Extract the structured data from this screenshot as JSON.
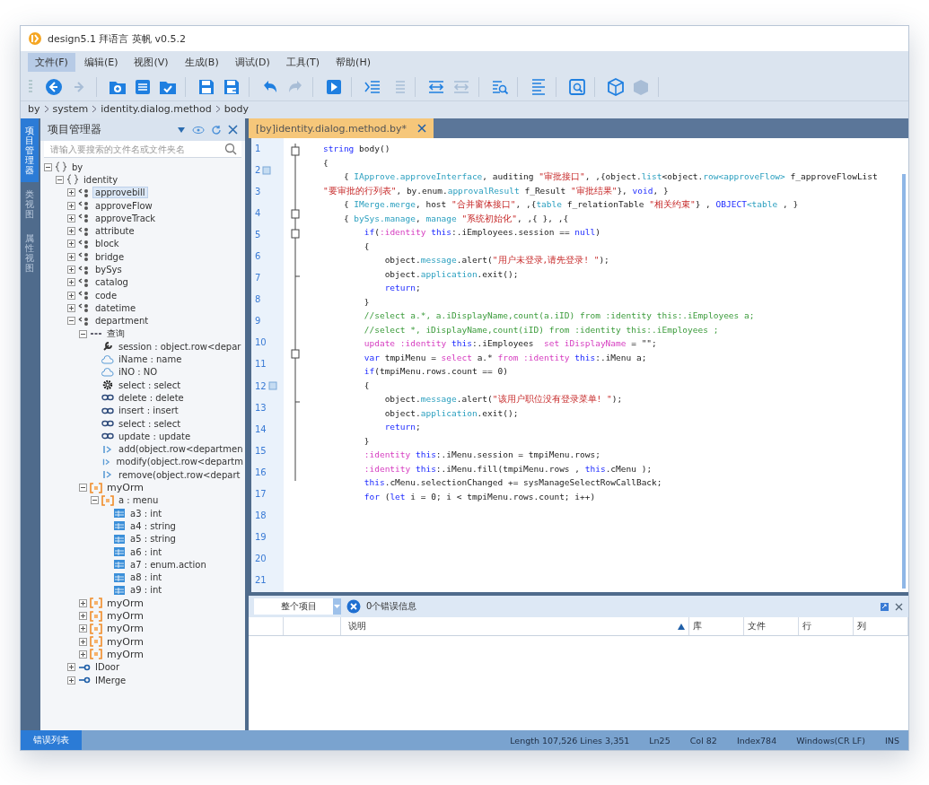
{
  "window": {
    "title": "design5.1 拜语言 英帆 v0.5.2"
  },
  "menu": [
    {
      "label": "文件(F)",
      "selected": true
    },
    {
      "label": "编辑(E)",
      "selected": false
    },
    {
      "label": "视图(V)",
      "selected": false
    },
    {
      "label": "生成(B)",
      "selected": false
    },
    {
      "label": "调试(D)",
      "selected": false
    },
    {
      "label": "工具(T)",
      "selected": false
    },
    {
      "label": "帮助(H)",
      "selected": false
    }
  ],
  "toolbar": [
    [
      {
        "kind": "back",
        "disabled": false
      },
      {
        "kind": "forward",
        "disabled": true
      }
    ],
    [
      {
        "kind": "new-folder",
        "disabled": false
      },
      {
        "kind": "list",
        "disabled": false
      },
      {
        "kind": "folder-check",
        "disabled": false
      }
    ],
    [
      {
        "kind": "save",
        "disabled": false
      },
      {
        "kind": "save-all",
        "disabled": false
      }
    ],
    [
      {
        "kind": "undo",
        "disabled": false
      },
      {
        "kind": "redo",
        "disabled": true
      }
    ],
    [
      {
        "kind": "run",
        "disabled": false
      }
    ],
    [
      {
        "kind": "indent",
        "disabled": false
      },
      {
        "kind": "outdent",
        "disabled": true
      }
    ],
    [
      {
        "kind": "expand",
        "disabled": false
      },
      {
        "kind": "collapse",
        "disabled": true
      }
    ],
    [
      {
        "kind": "find",
        "disabled": false
      }
    ],
    [
      {
        "kind": "document",
        "disabled": false
      }
    ],
    [
      {
        "kind": "window-search",
        "disabled": false
      }
    ],
    [
      {
        "kind": "cube",
        "disabled": false
      },
      {
        "kind": "stack",
        "disabled": true
      }
    ]
  ],
  "breadcrumb": [
    "by",
    "system",
    "identity.dialog.method",
    "body"
  ],
  "side_tabs": [
    {
      "label": "项目管理器",
      "selected": true
    },
    {
      "label": "类视图",
      "selected": false
    },
    {
      "label": "属性视图",
      "selected": false
    }
  ],
  "project_panel": {
    "title": "项目管理器",
    "search": {
      "placeholder": "请输入要搜索的文件名或文件夹名"
    },
    "tree": [
      {
        "label": "by",
        "kind": "namespace",
        "expanded": true,
        "selected": false,
        "children": [
          {
            "label": "identity",
            "kind": "namespace",
            "expanded": true,
            "selected": false,
            "children": [
              {
                "label": "approvebill",
                "kind": "class",
                "expanded": false,
                "selected": true
              },
              {
                "label": "approveFlow",
                "kind": "class",
                "expanded": false,
                "selected": false
              },
              {
                "label": "approveTrack",
                "kind": "class",
                "expanded": false,
                "selected": false
              },
              {
                "label": "attribute",
                "kind": "class",
                "expanded": false,
                "selected": false
              },
              {
                "label": "block",
                "kind": "class",
                "expanded": false,
                "selected": false
              },
              {
                "label": "bridge",
                "kind": "class",
                "expanded": false,
                "selected": false
              },
              {
                "label": "bySys",
                "kind": "class",
                "expanded": false,
                "selected": false
              },
              {
                "label": "catalog",
                "kind": "class",
                "expanded": false,
                "selected": false
              },
              {
                "label": "code",
                "kind": "class",
                "expanded": false,
                "selected": false
              },
              {
                "label": "datetime",
                "kind": "class",
                "expanded": false,
                "selected": false
              },
              {
                "label": "department",
                "kind": "class",
                "expanded": true,
                "selected": false,
                "children": [
                  {
                    "label": "查询",
                    "kind": "group",
                    "expanded": true,
                    "selected": false,
                    "children": [
                      {
                        "label": "session : object.row<depar",
                        "kind": "property",
                        "selected": false
                      },
                      {
                        "label": "iName : name",
                        "kind": "field",
                        "selected": false
                      },
                      {
                        "label": "iNO : NO",
                        "kind": "field",
                        "selected": false
                      },
                      {
                        "label": "select : select",
                        "kind": "method",
                        "selected": false
                      },
                      {
                        "label": "delete : delete",
                        "kind": "link",
                        "selected": false
                      },
                      {
                        "label": "insert : insert",
                        "kind": "link",
                        "selected": false
                      },
                      {
                        "label": "select : select",
                        "kind": "link",
                        "selected": false
                      },
                      {
                        "label": "update : update",
                        "kind": "link",
                        "selected": false
                      },
                      {
                        "label": "add(object.row<departmen",
                        "kind": "func",
                        "selected": false
                      },
                      {
                        "label": "modify(object.row<departm",
                        "kind": "func",
                        "selected": false
                      },
                      {
                        "label": "remove(object.row<depart",
                        "kind": "func",
                        "selected": false
                      }
                    ]
                  },
                  {
                    "label": "myOrm",
                    "kind": "orm",
                    "expanded": true,
                    "selected": false,
                    "children": [
                      {
                        "label": "a : menu",
                        "kind": "orm-column",
                        "selected": false,
                        "expanded": true,
                        "children": [
                          {
                            "label": "a3 : int",
                            "kind": "column",
                            "selected": false
                          },
                          {
                            "label": "a4 : string",
                            "kind": "column",
                            "selected": false
                          },
                          {
                            "label": "a5 : string",
                            "kind": "column",
                            "selected": false
                          },
                          {
                            "label": "a6 : int",
                            "kind": "column",
                            "selected": false
                          },
                          {
                            "label": "a7 : enum.action",
                            "kind": "column",
                            "selected": false
                          },
                          {
                            "label": "a8 : int",
                            "kind": "column",
                            "selected": false
                          },
                          {
                            "label": "a9 : int",
                            "kind": "column",
                            "selected": false
                          }
                        ]
                      }
                    ]
                  },
                  {
                    "label": "myOrm",
                    "kind": "orm",
                    "expanded": false,
                    "selected": false
                  },
                  {
                    "label": "myOrm",
                    "kind": "orm",
                    "expanded": false,
                    "selected": false
                  },
                  {
                    "label": "myOrm",
                    "kind": "orm",
                    "expanded": false,
                    "selected": false
                  },
                  {
                    "label": "myOrm",
                    "kind": "orm",
                    "expanded": false,
                    "selected": false
                  },
                  {
                    "label": "myOrm",
                    "kind": "orm",
                    "expanded": false,
                    "selected": false
                  }
                ]
              },
              {
                "label": "IDoor",
                "kind": "interface",
                "expanded": false,
                "selected": false
              },
              {
                "label": "IMerge",
                "kind": "interface",
                "expanded": false,
                "selected": false
              }
            ]
          }
        ]
      }
    ]
  },
  "editor": {
    "tab": {
      "label": "[by]identity.dialog.method.by*",
      "selected": true
    },
    "line_numbers": [
      {
        "n": "1",
        "bookmark": false
      },
      {
        "n": "2",
        "bookmark": true
      },
      {
        "n": "3",
        "bookmark": false
      },
      {
        "n": "4",
        "bookmark": false
      },
      {
        "n": "5",
        "bookmark": false
      },
      {
        "n": "6",
        "bookmark": false
      },
      {
        "n": "7",
        "bookmark": false
      },
      {
        "n": "8",
        "bookmark": false
      },
      {
        "n": "9",
        "bookmark": false
      },
      {
        "n": "10",
        "bookmark": false
      },
      {
        "n": "11",
        "bookmark": false
      },
      {
        "n": "12",
        "bookmark": true
      },
      {
        "n": "13",
        "bookmark": false
      },
      {
        "n": "14",
        "bookmark": false
      },
      {
        "n": "15",
        "bookmark": false
      },
      {
        "n": "16",
        "bookmark": false
      },
      {
        "n": "17",
        "bookmark": false
      },
      {
        "n": "18",
        "bookmark": false
      },
      {
        "n": "19",
        "bookmark": false
      },
      {
        "n": "20",
        "bookmark": false
      },
      {
        "n": "21",
        "bookmark": false
      }
    ],
    "lines": [
      [
        {
          "kind": "kw",
          "text": "string"
        },
        {
          "kind": "plain",
          "text": " body()"
        }
      ],
      [
        {
          "kind": "plain",
          "text": "{"
        }
      ],
      [
        {
          "kind": "plain",
          "text": "    { "
        },
        {
          "kind": "type",
          "text": "IApprove.approveInterface"
        },
        {
          "kind": "plain",
          "text": ", auditing "
        },
        {
          "kind": "str",
          "text": "\"审批接口\""
        },
        {
          "kind": "plain",
          "text": ", ,{object."
        },
        {
          "kind": "type",
          "text": "list"
        },
        {
          "kind": "plain",
          "text": "<object."
        },
        {
          "kind": "type",
          "text": "row<approveFlow>"
        },
        {
          "kind": "plain",
          "text": " f_approveFlowList "
        },
        {
          "kind": "str",
          "text": "\"要审批的行列表\""
        },
        {
          "kind": "plain",
          "text": ", by.enum."
        },
        {
          "kind": "type",
          "text": "approvalResult"
        },
        {
          "kind": "plain",
          "text": " f_Result "
        },
        {
          "kind": "str",
          "text": "\"审批结果\""
        },
        {
          "kind": "plain",
          "text": "}, "
        },
        {
          "kind": "kw",
          "text": "void"
        },
        {
          "kind": "plain",
          "text": ", }"
        }
      ],
      [
        {
          "kind": "plain",
          "text": "    { "
        },
        {
          "kind": "type",
          "text": "IMerge.merge"
        },
        {
          "kind": "plain",
          "text": ", host "
        },
        {
          "kind": "str",
          "text": "\"合并窗体接口\""
        },
        {
          "kind": "plain",
          "text": ", ,{"
        },
        {
          "kind": "type",
          "text": "table"
        },
        {
          "kind": "plain",
          "text": " f_relationTable "
        },
        {
          "kind": "str",
          "text": "\"相关约束\""
        },
        {
          "kind": "plain",
          "text": "} , "
        },
        {
          "kind": "kw",
          "text": "OBJECT"
        },
        {
          "kind": "type",
          "text": "<table"
        },
        {
          "kind": "plain",
          "text": " , }"
        }
      ],
      [
        {
          "kind": "plain",
          "text": "    { "
        },
        {
          "kind": "type",
          "text": "bySys.manage"
        },
        {
          "kind": "plain",
          "text": ", "
        },
        {
          "kind": "type",
          "text": "manage"
        },
        {
          "kind": "str",
          "text": " \"系统初始化\""
        },
        {
          "kind": "plain",
          "text": ", ,{ }, ,{"
        }
      ],
      [
        {
          "kind": "kw",
          "text": "        if"
        },
        {
          "kind": "plain",
          "text": "("
        },
        {
          "kind": "pink",
          "text": ":identity"
        },
        {
          "kind": "kw",
          "text": " this"
        },
        {
          "kind": "plain",
          "text": ":.iEmployees.session == "
        },
        {
          "kind": "kw",
          "text": "null"
        },
        {
          "kind": "plain",
          "text": ")"
        }
      ],
      [
        {
          "kind": "plain",
          "text": "        {"
        }
      ],
      [
        {
          "kind": "plain",
          "text": "            object."
        },
        {
          "kind": "type",
          "text": "message"
        },
        {
          "kind": "plain",
          "text": ".alert("
        },
        {
          "kind": "str",
          "text": "\"用户未登录,请先登录! \""
        },
        {
          "kind": "plain",
          "text": ");"
        }
      ],
      [
        {
          "kind": "plain",
          "text": "            object."
        },
        {
          "kind": "type",
          "text": "application"
        },
        {
          "kind": "plain",
          "text": ".exit();"
        }
      ],
      [
        {
          "kind": "kw",
          "text": "            return"
        },
        {
          "kind": "plain",
          "text": ";"
        }
      ],
      [
        {
          "kind": "plain",
          "text": "        }"
        }
      ],
      [
        {
          "kind": "cmt",
          "text": "        //select a.*, a.iDisplayName,count(a.iID) from :identity this:.iEmployees a;"
        }
      ],
      [
        {
          "kind": "cmt",
          "text": "        //select *, iDisplayName,count(iID) from :identity this:.iEmployees ;"
        }
      ],
      [
        {
          "kind": "pink",
          "text": "        update :identity"
        },
        {
          "kind": "kw",
          "text": " this"
        },
        {
          "kind": "plain",
          "text": ":.iEmployees  "
        },
        {
          "kind": "pink",
          "text": "set iDisplayName"
        },
        {
          "kind": "plain",
          "text": " = \"\";"
        }
      ],
      [
        {
          "kind": "kw",
          "text": "        var"
        },
        {
          "kind": "plain",
          "text": " tmpiMenu = "
        },
        {
          "kind": "pink",
          "text": "select"
        },
        {
          "kind": "plain",
          "text": " a.* "
        },
        {
          "kind": "pink",
          "text": "from :identity"
        },
        {
          "kind": "kw",
          "text": " this"
        },
        {
          "kind": "plain",
          "text": ":.iMenu a;"
        }
      ],
      [
        {
          "kind": "kw",
          "text": "        if"
        },
        {
          "kind": "plain",
          "text": "(tmpiMenu.rows.count == 0)"
        }
      ],
      [
        {
          "kind": "plain",
          "text": "        {"
        }
      ],
      [
        {
          "kind": "plain",
          "text": "            object."
        },
        {
          "kind": "type",
          "text": "message"
        },
        {
          "kind": "plain",
          "text": ".alert("
        },
        {
          "kind": "str",
          "text": "\"该用户职位没有登录菜单! \""
        },
        {
          "kind": "plain",
          "text": ");"
        }
      ],
      [
        {
          "kind": "plain",
          "text": "            object."
        },
        {
          "kind": "type",
          "text": "application"
        },
        {
          "kind": "plain",
          "text": ".exit();"
        }
      ],
      [
        {
          "kind": "kw",
          "text": "            return"
        },
        {
          "kind": "plain",
          "text": ";"
        }
      ],
      [
        {
          "kind": "plain",
          "text": "        }"
        }
      ],
      [
        {
          "kind": "pink",
          "text": "        :identity"
        },
        {
          "kind": "kw",
          "text": " this"
        },
        {
          "kind": "plain",
          "text": ":.iMenu.session = tmpiMenu.rows;"
        }
      ],
      [
        {
          "kind": "pink",
          "text": "        :identity"
        },
        {
          "kind": "kw",
          "text": " this"
        },
        {
          "kind": "plain",
          "text": ":.iMenu.fill(tmpiMenu.rows , "
        },
        {
          "kind": "kw",
          "text": "this"
        },
        {
          "kind": "plain",
          "text": ".cMenu );"
        }
      ],
      [
        {
          "kind": "kw",
          "text": "        this"
        },
        {
          "kind": "plain",
          "text": ".cMenu.selectionChanged += sysManageSelectRowCallBack;"
        }
      ],
      [
        {
          "kind": "kw",
          "text": "        for"
        },
        {
          "kind": "plain",
          "text": " ("
        },
        {
          "kind": "kw",
          "text": "let"
        },
        {
          "kind": "plain",
          "text": " i = 0; i < tmpiMenu.rows.count; i++)"
        }
      ]
    ]
  },
  "error_panel": {
    "scope": "整个项目",
    "summary": "0个错误信息",
    "columns": [
      {
        "label": "说明",
        "sorted": true
      },
      {
        "label": "库",
        "sorted": false
      },
      {
        "label": "文件",
        "sorted": false
      },
      {
        "label": "行",
        "sorted": false
      },
      {
        "label": "列",
        "sorted": false
      }
    ]
  },
  "bottom_tabs": [
    {
      "label": "错误列表",
      "selected": true
    }
  ],
  "status_bar": [
    "Length 107,526 Lines 3,351",
    "Ln25",
    "Col 82",
    "Index784",
    "Windows(CR LF)",
    "INS"
  ]
}
